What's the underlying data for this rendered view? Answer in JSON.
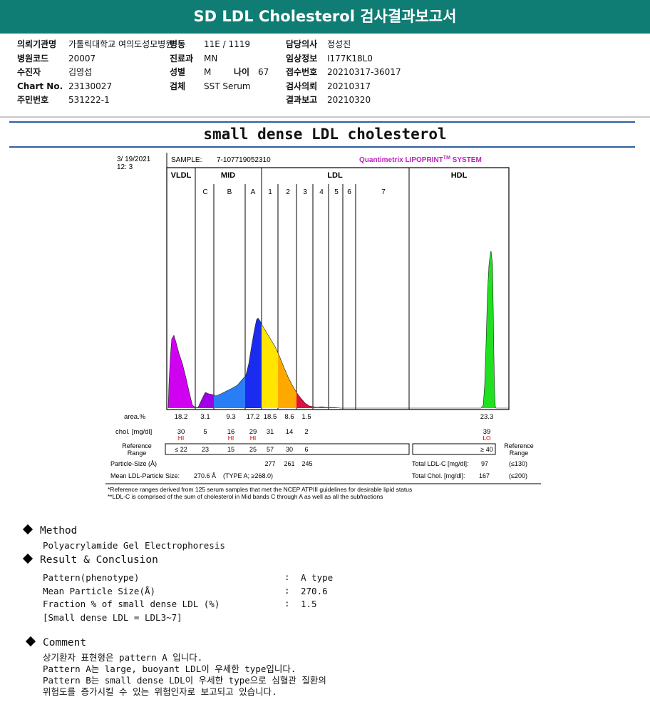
{
  "report_title": "SD LDL Cholesterol 검사결과보고서",
  "info": {
    "col1": [
      {
        "label": "의뢰기관명",
        "value": "가톨릭대학교 여의도성모병원"
      },
      {
        "label": "병원코드",
        "value": "20007"
      },
      {
        "label": "수진자",
        "value": "김영섭"
      },
      {
        "label": "Chart No.",
        "value": "23130027"
      },
      {
        "label": "주민번호",
        "value": "531222-1"
      }
    ],
    "col2": [
      {
        "label": "병동",
        "value": "11E / 1119"
      },
      {
        "label": "진료과",
        "value": "MN"
      },
      {
        "label": "성별",
        "value": "M"
      },
      {
        "label": "검체",
        "value": "SST Serum"
      }
    ],
    "age_label": "나이",
    "age_value": "67",
    "col3": [
      {
        "label": "담당의사",
        "value": "정성진"
      },
      {
        "label": "임상정보",
        "value": "I177K18L0"
      },
      {
        "label": "접수번호",
        "value": "20210317-36017"
      },
      {
        "label": "검사의뢰",
        "value": "20210317"
      },
      {
        "label": "결과보고",
        "value": "20210320"
      }
    ]
  },
  "doc_title": "small dense LDL cholesterol",
  "chart_data": {
    "type": "area",
    "date_line1": "3/ 19/2021",
    "date_line2": "12: 3",
    "sample_label": "SAMPLE:",
    "sample_id": "7-107719052310",
    "brand": "Quantimetrix LIPOPRINT",
    "brand_tm": "TM",
    "brand_suffix": " SYSTEM",
    "groups": [
      "VLDL",
      "MID",
      "LDL",
      "HDL"
    ],
    "bands": [
      "C",
      "B",
      "A",
      "1",
      "2",
      "3",
      "4",
      "5",
      "6",
      "7"
    ],
    "series_colors": {
      "VLDL": "#d000f0",
      "C": "#a000e8",
      "B": "#2a7ef5",
      "A": "#1a2cf0",
      "LDL1": "#ffe500",
      "LDL2": "#ffa800",
      "LDL3": "#e01040",
      "LDL4": "#f02060",
      "HDL": "#20e020"
    },
    "area_label": "area.%",
    "area": [
      "18.2",
      "3.1",
      "9.3",
      "17.2",
      "18.5",
      "8.6",
      "1.5",
      "23.3"
    ],
    "chol_label": "chol. [mg/dl]",
    "chol": [
      "30",
      "5",
      "16",
      "29",
      "31",
      "14",
      "2",
      "39"
    ],
    "flags": [
      "HI",
      "",
      "HI",
      "HI",
      "",
      "",
      "",
      "LO"
    ],
    "ref_label_1": "Reference",
    "ref_label_2": "Range",
    "ref_range": [
      "≤ 22",
      "23",
      "15",
      "25",
      "57",
      "30",
      "6",
      "≥ 40"
    ],
    "ref_right_1": "Reference",
    "ref_right_2": "Range",
    "particle_label": "Particle-Size (Å)",
    "particle_values": [
      "277",
      "261",
      "245"
    ],
    "mean_label": "Mean LDL-Particle Size:",
    "mean_value": "270.6 Å",
    "mean_type": "(TYPE A; ≥268.0)",
    "total_ldl_label": "Total LDL-C [mg/dl]:",
    "total_ldl_value": "97",
    "total_ldl_ref": "(≤130)",
    "total_chol_label": "Total Chol. [mg/dl]:",
    "total_chol_value": "167",
    "total_chol_ref": "(≤200)",
    "footnote1": "*Reference ranges derived from 125 serum samples that met the NCEP ATPIII guidelines for desirable lipid status",
    "footnote2": "**LDL-C is comprised of the sum of cholesterol in Mid bands C through A as well as all the subfractions"
  },
  "method": {
    "title": "Method",
    "text": "Polyacrylamide Gel Electrophoresis"
  },
  "result": {
    "title": "Result & Conclusion",
    "rows": [
      {
        "label": "Pattern(phenotype)",
        "sep": ":",
        "value": "A type"
      },
      {
        "label": "Mean Particle Size(Å)",
        "sep": ":",
        "value": "270.6"
      },
      {
        "label": "Fraction % of small dense LDL (%)",
        "sep": ":",
        "value": "1.5"
      }
    ],
    "note": "[Small dense LDL = LDL3~7]"
  },
  "comment": {
    "title": "Comment",
    "lines": [
      "상기환자 표현형은 pattern A 입니다.",
      "Pattern A는 large, buoyant LDL이 우세한 type입니다.",
      "Pattern B는 small dense LDL이 우세한 type으로 심혈관 질환의",
      "위험도를 증가시킬 수 있는 위험인자로 보고되고 있습니다."
    ]
  }
}
